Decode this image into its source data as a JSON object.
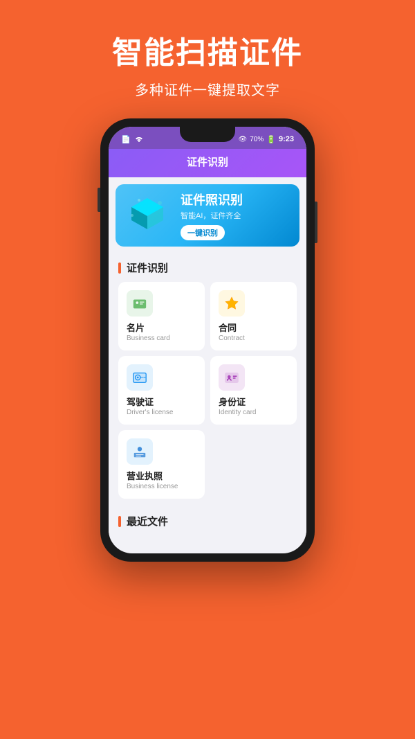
{
  "header": {
    "title": "智能扫描证件",
    "subtitle": "多种证件一键提取文字"
  },
  "phone": {
    "statusBar": {
      "time": "9:23",
      "battery": "70%"
    },
    "appBar": {
      "title": "证件识别"
    },
    "banner": {
      "title": "证件照识别",
      "subtitle": "智能AI，证件齐全",
      "buttonLabel": "一键识别"
    },
    "sections": [
      {
        "id": "cert-section",
        "title": "证件识别",
        "items": [
          {
            "id": "business-card",
            "name": "名片",
            "subtitle": "Business card",
            "iconColor": "green",
            "iconType": "card"
          },
          {
            "id": "contract",
            "name": "合同",
            "subtitle": "Contract",
            "iconColor": "yellow",
            "iconType": "star"
          },
          {
            "id": "drivers-license",
            "name": "驾驶证",
            "subtitle": "Driver's license",
            "iconColor": "blue",
            "iconType": "wheel"
          },
          {
            "id": "identity-card",
            "name": "身份证",
            "subtitle": "Identity card",
            "iconColor": "purple",
            "iconType": "person"
          },
          {
            "id": "business-license",
            "name": "营业执照",
            "subtitle": "Business license",
            "iconColor": "blue",
            "iconType": "building"
          }
        ]
      },
      {
        "id": "recent-section",
        "title": "最近文件"
      }
    ]
  }
}
